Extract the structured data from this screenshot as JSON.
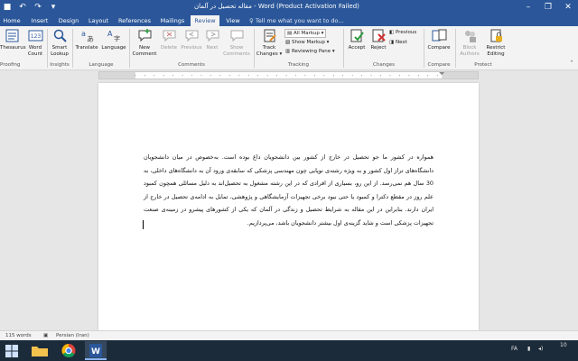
{
  "window": {
    "title": "مقاله تحصیل در آلمان - Word (Product Activation Failed)",
    "controls": [
      "–",
      "❐",
      "✕"
    ]
  },
  "ribbon_tabs": [
    "Home",
    "Insert",
    "Design",
    "Layout",
    "References",
    "Mailings",
    "Review",
    "View"
  ],
  "tell_me": "Tell me what you want to do...",
  "ribbon": {
    "proofing": {
      "thesaurus": "Thesaurus",
      "word_count_1": "Word",
      "word_count_2": "Count",
      "group": "Proofing"
    },
    "insights": {
      "smart_lookup_1": "Smart",
      "smart_lookup_2": "Lookup",
      "group": "Insights"
    },
    "language": {
      "translate": "Translate",
      "language": "Language",
      "group": "Language"
    },
    "comments": {
      "new_1": "New",
      "new_2": "Comment",
      "delete": "Delete",
      "previous": "Previous",
      "next": "Next",
      "show_1": "Show",
      "show_2": "Comments",
      "group": "Comments"
    },
    "tracking": {
      "track_1": "Track",
      "track_2": "Changes",
      "markup_select": "All Markup",
      "show_markup": "Show Markup",
      "reviewing_pane": "Reviewing Pane",
      "group": "Tracking"
    },
    "changes": {
      "accept": "Accept",
      "reject": "Reject",
      "previous": "Previous",
      "next": "Next",
      "group": "Changes"
    },
    "compare": {
      "compare": "Compare",
      "group": "Compare"
    },
    "protect": {
      "block_1": "Block",
      "block_2": "Authors",
      "restrict_1": "Restrict",
      "restrict_2": "Editing",
      "group": "Protect"
    }
  },
  "document": {
    "paragraph": "همواره در کشور ما جو تحصیل در خارج از کشور بین دانشجویان داغ بوده است. به‌خصوص در میان دانشجویان دانشگاه‌های تراز اول کشور و به ویژه رشته‌ی نوپایی چون مهندسی پزشکی که سابقه‌ی ورود آن به دانشگاه‌های داخلی، به 30 سال هم نمی‌رسد. از این رو، بسیاری از افرادی که در این رشته مشغول به تحصیل‌اند به دلیل مسائلی همچون کمبود علم روز در مقطع دکترا و کمبود یا حتی نبود برخی تجهیزات آزمایشگاهی و پژوهشی، تمایل به ادامه‌ی تحصیل در خارج از ایران دارند. بنابراین در این مقاله به شرایط تحصیل و زندگی در آلمان که یکی از کشورهای پیشرو در زمینه‌ی صنعت تجهیزات پزشکی است و شاید گزینه‌ی اول بیشتر دانشجویان باشد، می‌پردازیم."
  },
  "status": {
    "words": "115 words",
    "language": "Persian (Iran)"
  },
  "taskbar": {
    "lang": "FA",
    "clock": "10"
  },
  "colors": {
    "word_blue": "#2b579a",
    "ribbon_bg": "#f3f3f3"
  }
}
